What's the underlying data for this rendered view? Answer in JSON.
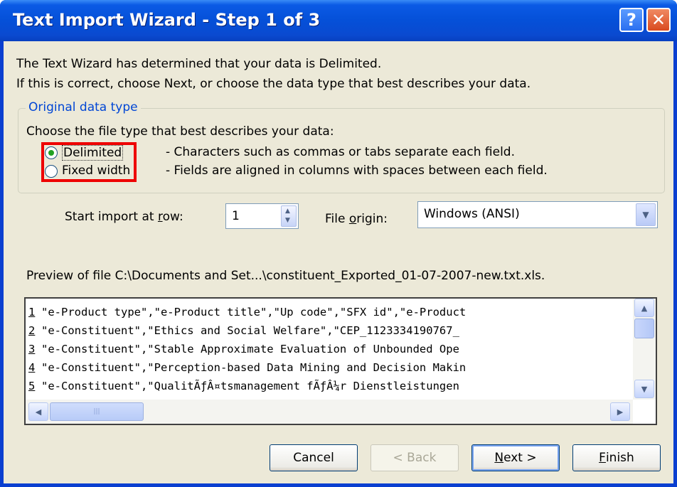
{
  "window": {
    "title": "Text Import Wizard - Step 1 of 3",
    "help_label": "?",
    "close_label": "✕"
  },
  "intro": {
    "line1": "The Text Wizard has determined that your data is Delimited.",
    "line2": "If this is correct, choose Next, or choose the data type that best describes your data."
  },
  "original_data_type": {
    "legend": "Original data type",
    "prompt": "Choose the file type that best describes your data:",
    "options": [
      {
        "label": "Delimited",
        "description": "- Characters such as commas or tabs separate each field.",
        "selected": true
      },
      {
        "label": "Fixed width",
        "description": "- Fields are aligned in columns with spaces between each field.",
        "selected": false
      }
    ]
  },
  "start_row": {
    "label_pre": "Start import at ",
    "label_u": "r",
    "label_post": "ow:",
    "value": "1"
  },
  "file_origin": {
    "label_pre": "File ",
    "label_u": "o",
    "label_post": "rigin:",
    "value": "Windows (ANSI)"
  },
  "preview": {
    "caption": "Preview of file C:\\Documents and Set...\\constituent_Exported_01-07-2007-new.txt.xls.",
    "rows": [
      {
        "num": "1",
        "text": "\"e-Product type\",\"e-Product title\",\"Up code\",\"SFX id\",\"e-Product"
      },
      {
        "num": "2",
        "text": "\"e-Constituent\",\"Ethics and Social Welfare\",\"CEP_1123334190767_"
      },
      {
        "num": "3",
        "text": "\"e-Constituent\",\"Stable Approximate Evaluation of Unbounded Ope"
      },
      {
        "num": "4",
        "text": "\"e-Constituent\",\"Perception-based Data Mining and Decision Makin"
      },
      {
        "num": "5",
        "text": "\"e-Constituent\",\"QualitÃƒÂ¤tsmanagement fÃƒÂ¼r Dienstleistungen"
      }
    ]
  },
  "buttons": {
    "cancel": "Cancel",
    "back": "< Back",
    "next_u": "N",
    "next_rest": "ext >",
    "finish_u": "F",
    "finish_rest": "inish"
  },
  "colors": {
    "titlebar": "#0a4ad0",
    "dialog_bg": "#ece9d8",
    "legend_text": "#0046d5",
    "highlight": "#ee0000"
  }
}
